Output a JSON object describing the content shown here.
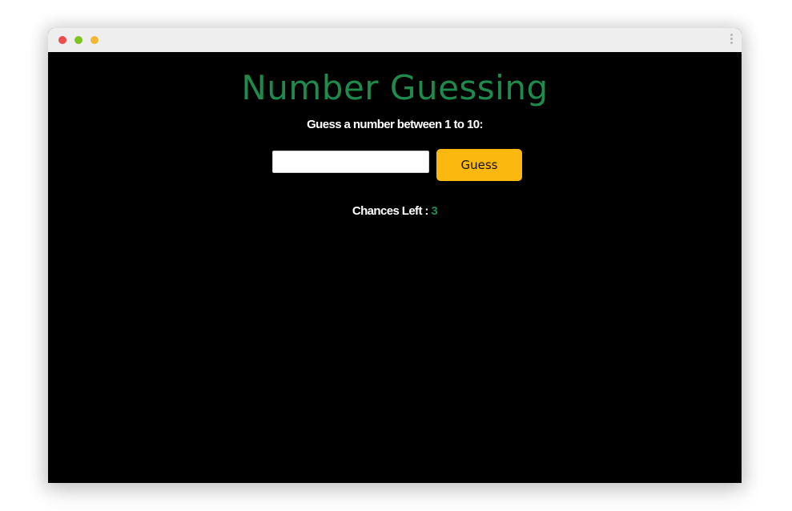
{
  "colors": {
    "background": "#000000",
    "title": "#1f8a4c",
    "text": "#ffffff",
    "button": "#fbb80f",
    "chances_value": "#1f8a4c"
  },
  "window": {
    "controls": [
      "close-dot",
      "minimize-dot",
      "maximize-dot"
    ],
    "menu_icon": "kebab-menu-icon"
  },
  "game": {
    "title": "Number Guessing",
    "instruction": "Guess a number between 1 to 10:",
    "input": {
      "value": "",
      "placeholder": ""
    },
    "guess_button_label": "Guess",
    "chances_label": "Chances Left : ",
    "chances_value": "3"
  }
}
